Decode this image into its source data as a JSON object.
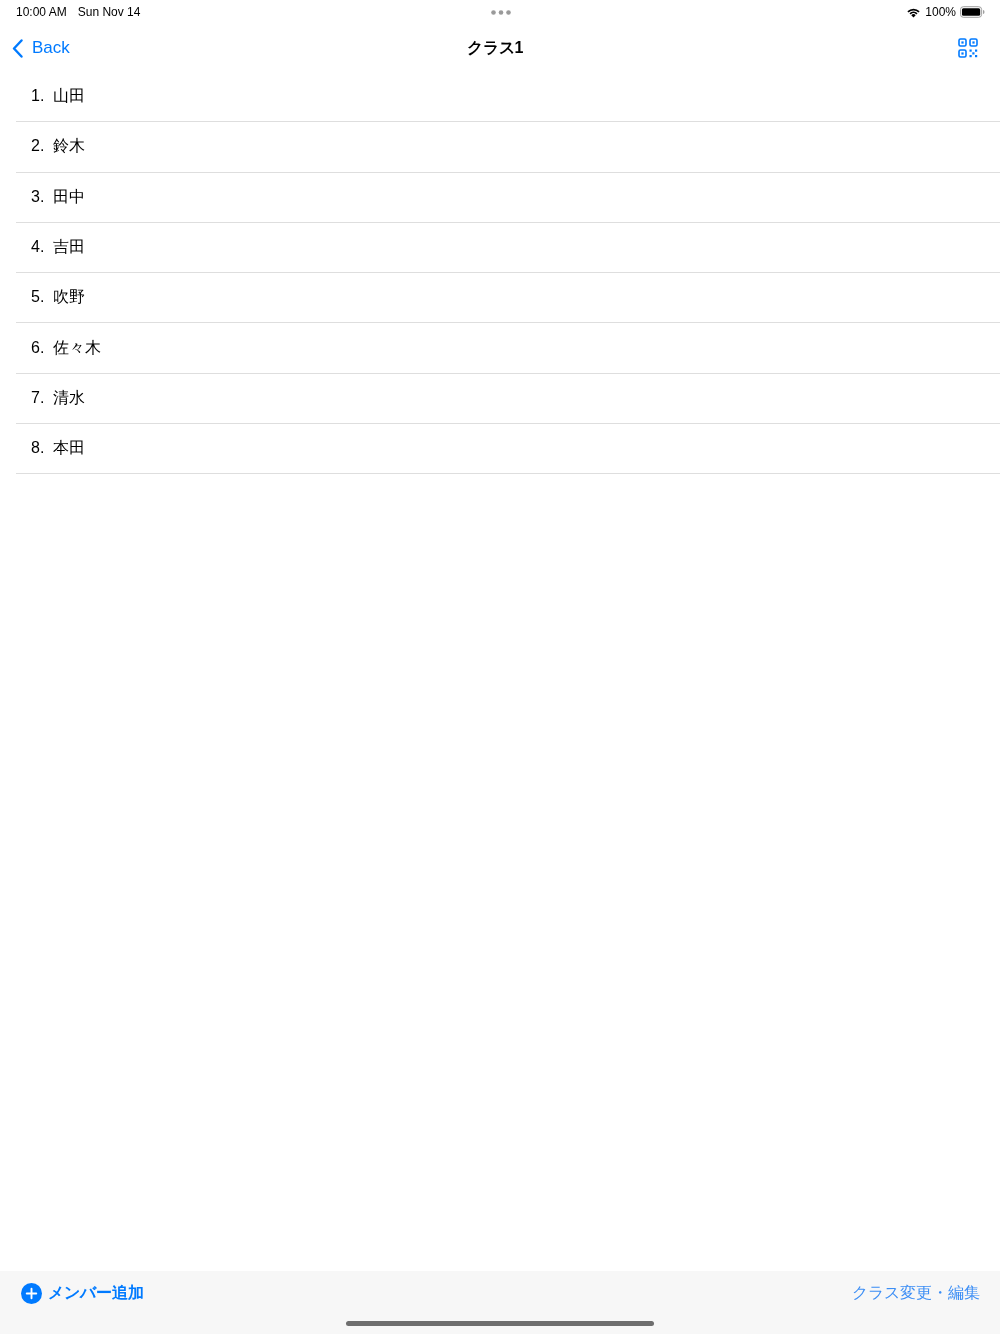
{
  "status_bar": {
    "time": "10:00 AM",
    "date": "Sun Nov 14",
    "battery_percent": "100%"
  },
  "nav_bar": {
    "back_label": "Back",
    "title": "クラス1"
  },
  "members": [
    {
      "label": "1.  山田"
    },
    {
      "label": "2.  鈴木"
    },
    {
      "label": "3.  田中"
    },
    {
      "label": "4.  吉田"
    },
    {
      "label": "5.  吹野"
    },
    {
      "label": "6.  佐々木"
    },
    {
      "label": "7.  清水"
    },
    {
      "label": "8.  本田"
    }
  ],
  "toolbar": {
    "add_label": "メンバー追加",
    "edit_label": "クラス変更・編集"
  }
}
